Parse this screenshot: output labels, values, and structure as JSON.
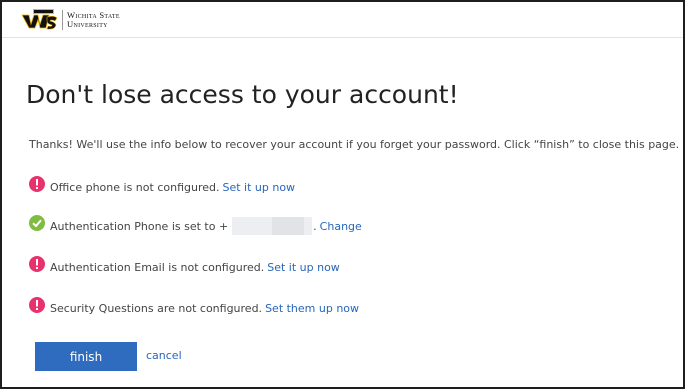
{
  "header": {
    "logo_monogram": "WSU",
    "university_line1": "Wichita State",
    "university_line2": "University"
  },
  "page": {
    "title": "Don't lose access to your account!",
    "intro": "Thanks! We'll use the info below to recover your account if you forget your password. Click “finish” to close this page."
  },
  "methods": [
    {
      "status": "warning",
      "text": "Office phone is not configured.",
      "link": "Set it up now"
    },
    {
      "status": "ok",
      "text": "Authentication Phone is set to +",
      "suffix": ".",
      "link": "Change"
    },
    {
      "status": "warning",
      "text": "Authentication Email is not configured.",
      "link": "Set it up now"
    },
    {
      "status": "warning",
      "text": "Security Questions are not configured.",
      "link": "Set them up now"
    }
  ],
  "actions": {
    "finish_label": "finish",
    "cancel_label": "cancel"
  },
  "colors": {
    "warning": "#e8326e",
    "ok": "#7fbc41",
    "link": "#2866b8",
    "primary_button": "#2f6bbf"
  }
}
